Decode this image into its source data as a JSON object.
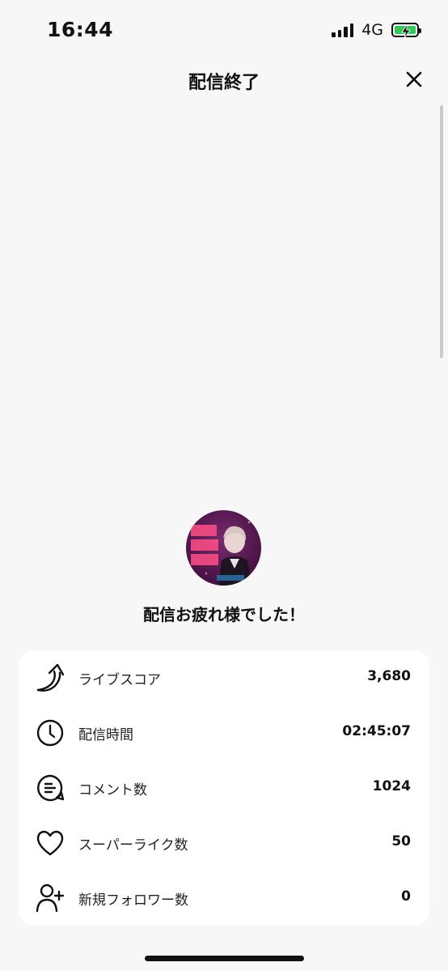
{
  "status": {
    "time": "16:44",
    "network": "4G"
  },
  "header": {
    "title": "配信終了"
  },
  "main": {
    "thanks_message": "配信お疲れ様でした！"
  },
  "stats": [
    {
      "icon": "arrow-up-icon",
      "label": "ライブスコア",
      "value": "3,680"
    },
    {
      "icon": "clock-icon",
      "label": "配信時間",
      "value": "02:45:07"
    },
    {
      "icon": "comment-icon",
      "label": "コメント数",
      "value": "1024"
    },
    {
      "icon": "heart-icon",
      "label": "スーパーライク数",
      "value": "50"
    },
    {
      "icon": "add-user-icon",
      "label": "新規フォロワー数",
      "value": "0"
    }
  ],
  "colors": {
    "background": "#f7f7f7",
    "card": "#ffffff",
    "battery": "#34c759",
    "avatar_bg": "#5a1a55",
    "avatar_text": "#ff5a8a"
  }
}
